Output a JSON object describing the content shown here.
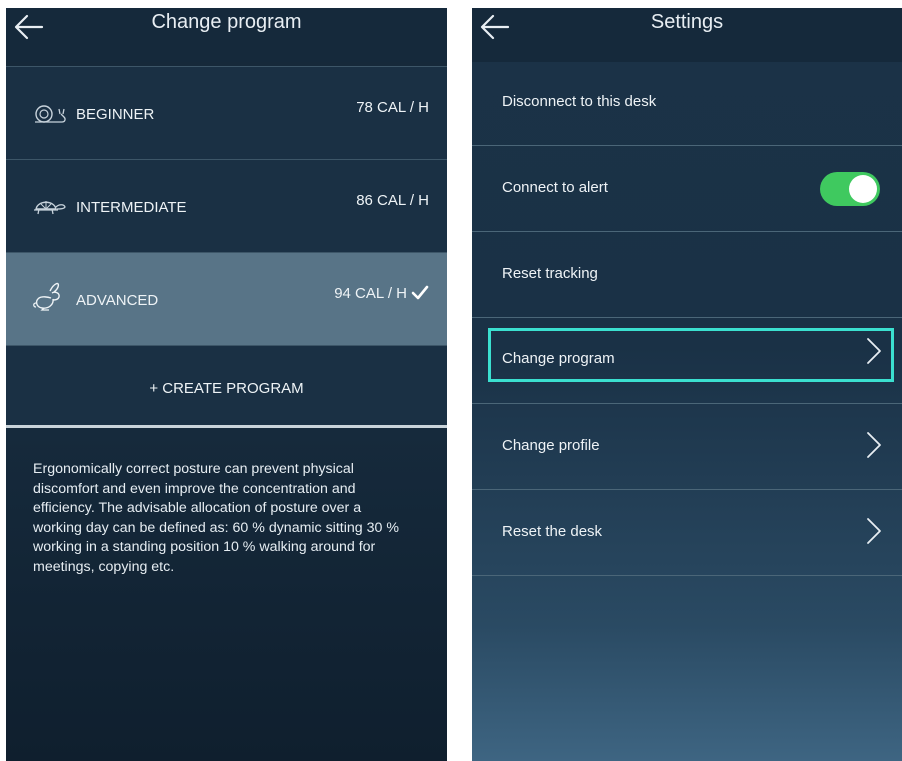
{
  "left_screen": {
    "title": "Change program",
    "programs": [
      {
        "name": "BEGINNER",
        "calories": "78 CAL / H",
        "icon": "snail-icon",
        "selected": false
      },
      {
        "name": "INTERMEDIATE",
        "calories": "86 CAL / H",
        "icon": "turtle-icon",
        "selected": false
      },
      {
        "name": "ADVANCED",
        "calories": "94 CAL / H",
        "icon": "rabbit-icon",
        "selected": true
      }
    ],
    "create_label": "+ CREATE PROGRAM",
    "description": "Ergonomically correct posture can prevent physical discomfort and even improve the concentration and efficiency. The advisable allocation of posture over a working day can be defined as: 60 % dynamic sitting 30 % working in a standing position 10 % walking around for meetings, copying etc."
  },
  "right_screen": {
    "title": "Settings",
    "items": [
      {
        "label": "Disconnect to this desk"
      },
      {
        "label": "Connect to alert",
        "toggle_on": true
      },
      {
        "label": "Reset tracking"
      },
      {
        "label": "Change program",
        "highlighted": true
      },
      {
        "label": "Change profile"
      },
      {
        "label": "Reset the desk"
      }
    ]
  },
  "colors": {
    "toggle_on": "#3fc95f",
    "highlight": "#3be0d0",
    "selected_row": "#587487",
    "background": "#16293a"
  }
}
